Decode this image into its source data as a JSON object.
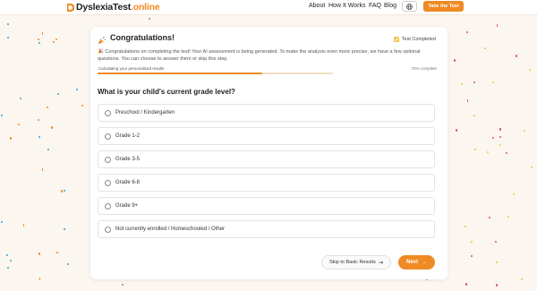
{
  "colors": {
    "accent": "#f08a24",
    "background": "#fbf6ef",
    "progress_track": "#f3dfc6"
  },
  "header": {
    "logo_text": "DyslexiaTest",
    "logo_tld": ".online",
    "nav": [
      "About",
      "How It Works",
      "FAQ",
      "Blog"
    ],
    "language_icon": "globe-icon",
    "cta_label": "Take the Test"
  },
  "card": {
    "title_icon": "party-popper-icon",
    "title": "Congratulations!",
    "status_icon": "check-icon",
    "status": "Test Completed",
    "intro": "🎉 Congratulations on completing the test! Your AI assessment is being generated. To make the analysis even more precise, we have a few optional questions. You can choose to answer them or skip this step.",
    "progress_label": "Calculating your personalized results",
    "progress_text": "70% complete",
    "progress_value": 0.7,
    "question": "What is your child's current grade level?",
    "options": [
      "Preschool / Kindergarten",
      "Grade 1-2",
      "Grade 3-5",
      "Grade 6-8",
      "Grade 9+",
      "Not currently enrolled / Homeschooled / Other"
    ],
    "skip_label": "Skip to Basic Results",
    "skip_icon": "arrow-right-icon",
    "next_label": "Next",
    "next_icon": "arrow-right-icon"
  }
}
